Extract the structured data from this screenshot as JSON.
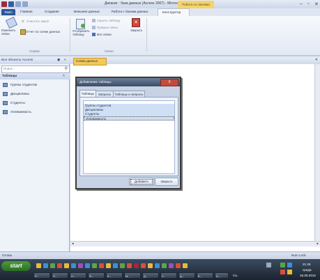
{
  "window": {
    "title": "Деканат : база данных (Access 2007) - Microsoft Access",
    "context_tab": "Работа со связями"
  },
  "ribbon_tabs": [
    "Файл",
    "Главная",
    "Создание",
    "Внешние данные",
    "Работа с базами данных",
    "Конструктор"
  ],
  "ribbon": {
    "edit_links_label": "Изменить связи",
    "clear_layout_label": "Очистить макет",
    "report_label": "Отчет по схеме данных",
    "group_tools": "Сервис",
    "show_table_label": "Отобразить таблицу",
    "hide_table_label": "Скрыть таблицу",
    "direct_links_label": "Прямые связи",
    "all_links_label": "Все связи",
    "close_label": "Закрыть",
    "group_links": "Связи"
  },
  "nav": {
    "header": "Все объекты Access",
    "search_placeholder": "Поиск...",
    "group": "Таблицы",
    "items": [
      "Группы студентов",
      "Дисциплины",
      "Студенты",
      "Успеваемость"
    ]
  },
  "document_tab": "Схема данных",
  "dialog": {
    "title": "Добавление таблицы",
    "close_label": "X",
    "tabs": [
      "Таблицы",
      "Запросы",
      "Таблицы и запросы"
    ],
    "list": [
      "Группы студентов",
      "Дисциплины",
      "Студенты",
      "Успеваемость"
    ],
    "add_button": "Добавить",
    "close_button": "Закрыть"
  },
  "statusbar": {
    "left": "Готово",
    "right": "Num Lock"
  },
  "taskbar": {
    "start": "start",
    "tasks": [
      "Р...",
      "П...",
      "Н...",
      "Я...",
      "К...",
      "М...",
      "Д...",
      "З...",
      "Д...",
      "Б...",
      "А..."
    ],
    "lang": "СЬ",
    "time": "21:26",
    "day": "среда",
    "date": "16.05.2012"
  },
  "colors": {
    "accent": "#2b5797",
    "context": "#f3d36b",
    "taskbar": "#1b2430"
  }
}
